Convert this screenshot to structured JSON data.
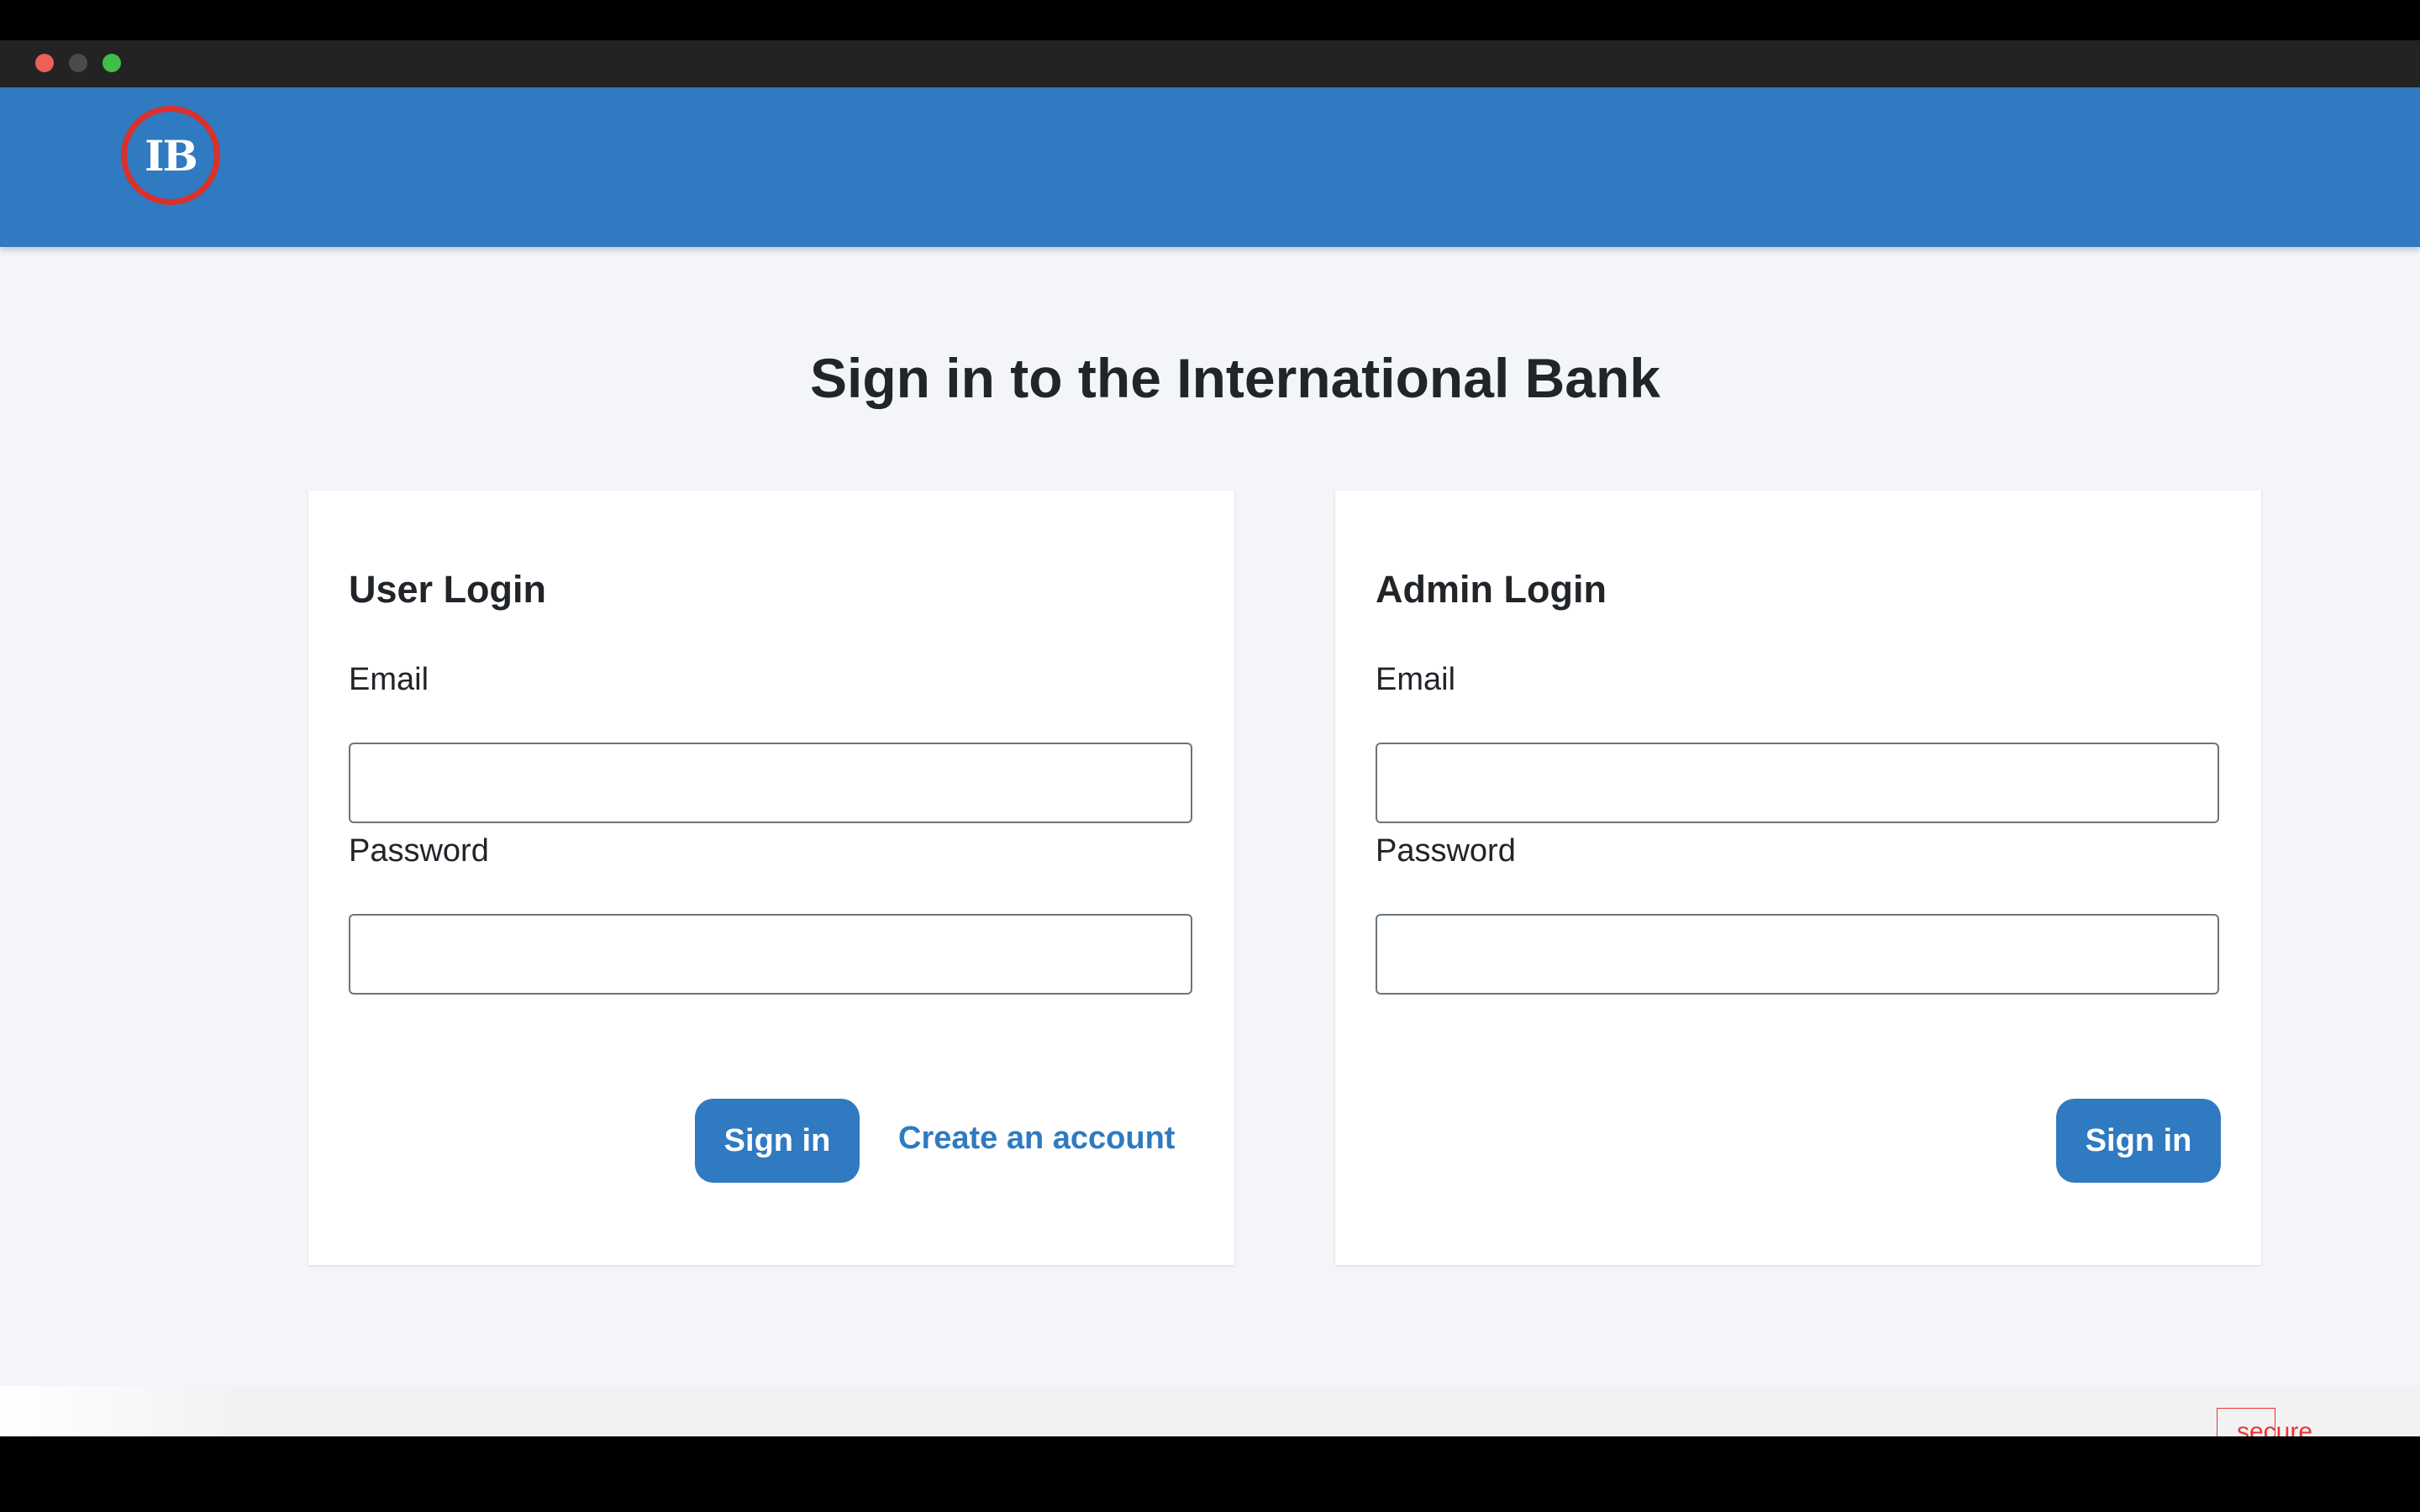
{
  "window": {
    "controls": [
      "close",
      "minimize",
      "maximize"
    ]
  },
  "header": {
    "logo_text": "IB",
    "brand_color": "#2f7ac0",
    "logo_ring_color": "#d9312b"
  },
  "main": {
    "title": "Sign in to the International Bank",
    "user_login": {
      "heading": "User Login",
      "email_label": "Email",
      "email_value": "",
      "password_label": "Password",
      "password_value": "",
      "sign_in_label": "Sign in",
      "create_account_label": "Create an account"
    },
    "admin_login": {
      "heading": "Admin Login",
      "email_label": "Email",
      "email_value": "",
      "password_label": "Password",
      "password_value": "",
      "sign_in_label": "Sign in"
    }
  },
  "footer": {
    "secure_text": "secure",
    "secure_color": "#e33333"
  }
}
